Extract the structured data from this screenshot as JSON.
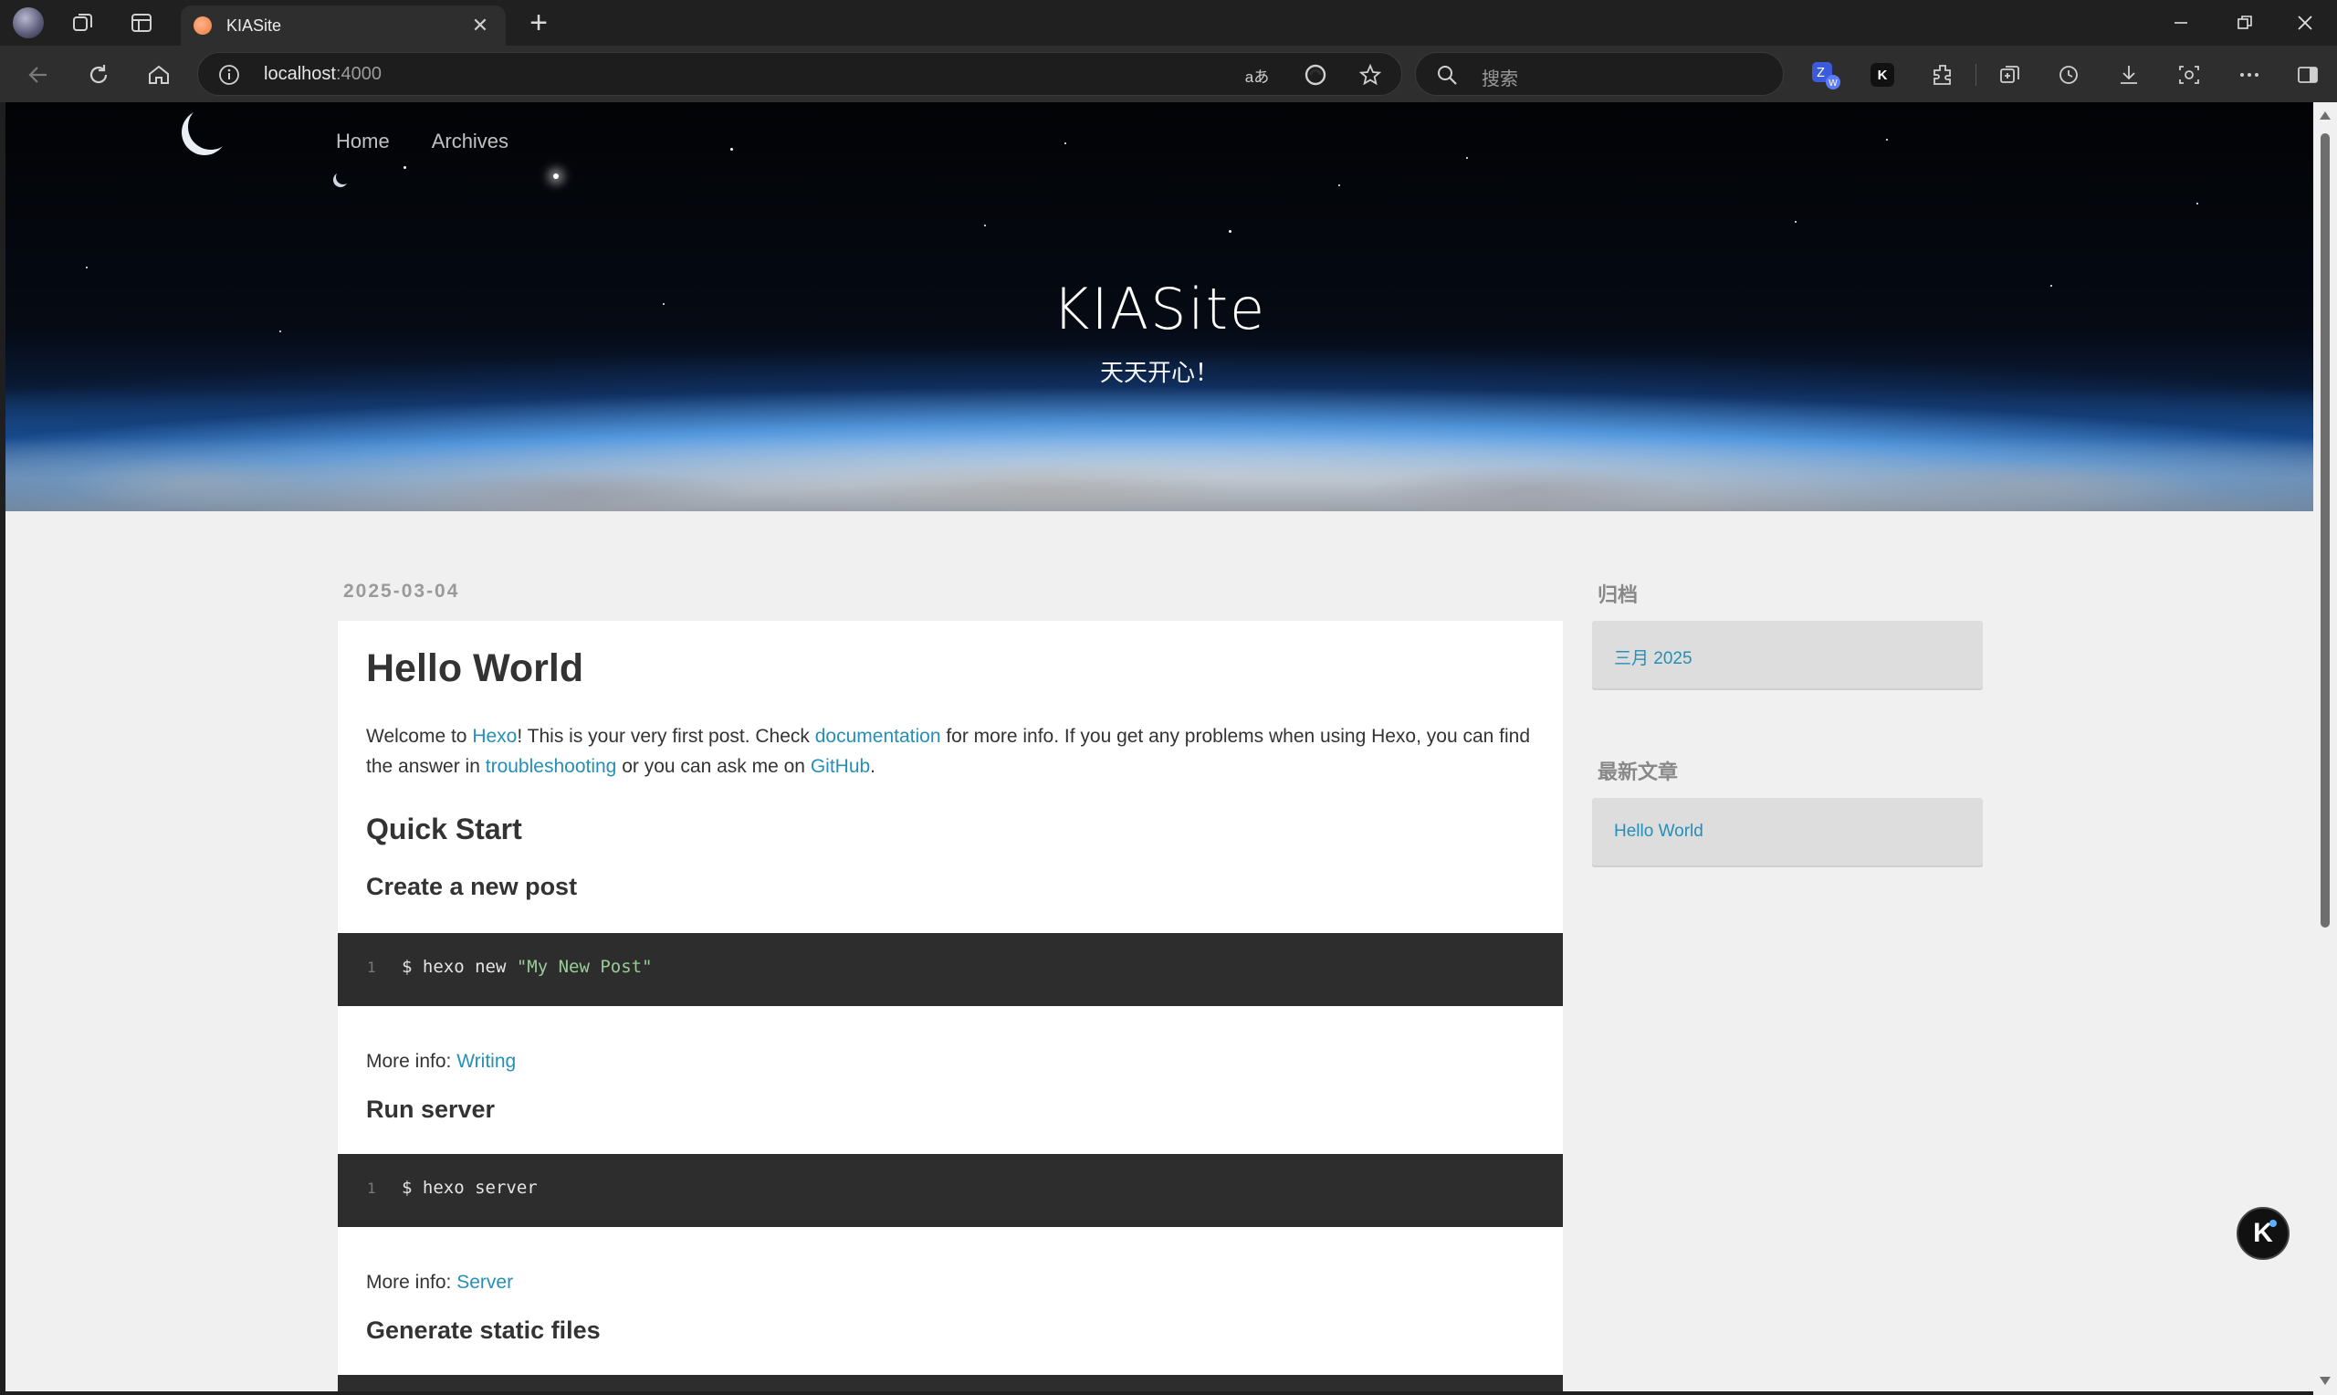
{
  "browser": {
    "tab_title": "KIASite",
    "tab_close": "✕",
    "new_tab": "+",
    "url_host": "localhost",
    "url_port": ":4000",
    "read_aloud_label": "aあ",
    "search_placeholder": "搜索",
    "extension_k_label": "K"
  },
  "site": {
    "nav": [
      "Home",
      "Archives"
    ],
    "title": "KIASite",
    "subtitle": "天天开心！"
  },
  "post": {
    "date": "2025-03-04",
    "title": "Hello World",
    "intro": {
      "t1": "Welcome to ",
      "link1": "Hexo",
      "t2": "! This is your very first post. Check ",
      "link2": "documentation",
      "t3": " for more info. If you get any problems when using Hexo, you can find the answer in ",
      "link3": "troubleshooting",
      "t4": " or you can ask me on ",
      "link4": "GitHub",
      "t5": "."
    },
    "quick_start": "Quick Start",
    "sections": [
      {
        "heading": "Create a new post",
        "line_no": "1",
        "cmd": "$ hexo new ",
        "cmd_str": "\"My New Post\"",
        "more_label": "More info: ",
        "more_link": "Writing"
      },
      {
        "heading": "Run server",
        "line_no": "1",
        "cmd": "$ hexo server",
        "cmd_str": "",
        "more_label": "More info: ",
        "more_link": "Server"
      },
      {
        "heading": "Generate static files"
      }
    ]
  },
  "sidebar": {
    "archive_title": "归档",
    "archive_item": "三月 2025",
    "recent_title": "最新文章",
    "recent_item": "Hello World"
  },
  "floating_button": {
    "label": "K"
  },
  "colors": {
    "link": "#258fb8",
    "code_bg": "#2d2d2d",
    "page_bg": "#f0f0f0",
    "browser_dark": "#202020"
  }
}
